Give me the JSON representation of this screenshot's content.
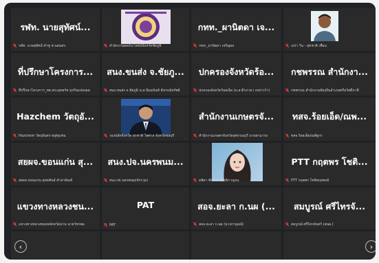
{
  "tiles": [
    {
      "name": "รฬท. นายสุทัศน์...",
      "caption": "รฬท. นายสุทัศน์ คำซู ช.นสนสร."
    },
    {
      "name": "",
      "caption": "สำนักงานผลประโยชน์จังหวัดชัยภูมิ"
    },
    {
      "name": "กทท._ผานิตดา เจ...",
      "caption": "กทท._ผานิตดา เจริญผล"
    },
    {
      "name": "",
      "caption": "เอร่า วิน - สุขชาติ เพื่อน"
    },
    {
      "name": "ที่ปรึกษาโครงการ...",
      "caption": "ที่ปรึกษาโครงการ_ทต.สระสุทธรัช ธุรกิจแปลงผล"
    },
    {
      "name": "สนง.ขนส่ง จ.ชัยภู...",
      "caption": "สนง.ขนส่ง จ.ชัยภูมิ น.ส.นิ่มอนันต์ สังกรณ์ทรัพย์"
    },
    {
      "name": "ปกครองจังหวัดร้อ...",
      "caption": "ปกครองจังหวัดร้อยเอ็ด (น.ส.ดีรภาดา เหล่ากว้า)"
    },
    {
      "name": "กชพรรณ สำนักงา...",
      "caption": "กชพรรณ สำนักงานท้องถิ่นอำเภอศรีสวัสดิ์ภาคี"
    },
    {
      "name": "Hazchem วัตถุอั...",
      "caption": "Hazchem วัตถุอันตรายสู่ชุมชน"
    },
    {
      "name": "",
      "caption": "รองปลัดจังหวัด สุรชาติ ไพศาล จังหวัดชลบุรี"
    },
    {
      "name": "สำนักงานเกษตรจั...",
      "caption": "สำนักงานเกษตรจังหวัดสุพรรณบุรี นายสามารถ"
    },
    {
      "name": "ทสจ.ร้อยเอ็ด/ณพ...",
      "caption": "ทสจ.ร้อยเอ็ด/ณพัฐกร"
    },
    {
      "name": "สยผจ.ขอนแก่น สุ...",
      "caption": "สยผจ.ขอนแก่น สุทธพันธ์ คำสายัณห์"
    },
    {
      "name": "สนง.ปจ.นครพนม...",
      "caption": "สนง.ปจ.นครพนม(จักรวุธ)"
    },
    {
      "name": "",
      "caption": "ดลิตา พัชรินทร์สิทธิกาญจน"
    },
    {
      "name": "PTT กฤตพร โชติ...",
      "caption": "PTT กฤตพร โชติสกุลพงษ์"
    },
    {
      "name": "แขวงทางหลวงชน...",
      "caption": "แขวงทางหลวงชนบทจังหวัดน่าน นายวัชรพล"
    },
    {
      "name": "PAT",
      "caption": "PAT"
    },
    {
      "name": "สอจ.ยะลา ก.นผ (...",
      "caption": "สอจ.ยะลา ก.นผ (นางกาญจน์)"
    },
    {
      "name": "สมบูรณ์ ศรีไทรจั...",
      "caption": "สมบูรณ์ ศรีไทรจันทร์ (สนผ.)"
    },
    {
      "name": "",
      "caption": ""
    },
    {
      "name": "",
      "caption": ""
    },
    {
      "name": "",
      "caption": ""
    },
    {
      "name": "",
      "caption": ""
    }
  ],
  "nav": {
    "prev": "‹",
    "next": "›"
  },
  "colors": {
    "tile_bg": "#2a2a2a",
    "frame_bg": "#202124",
    "muted_mic": "#e23b3b"
  }
}
